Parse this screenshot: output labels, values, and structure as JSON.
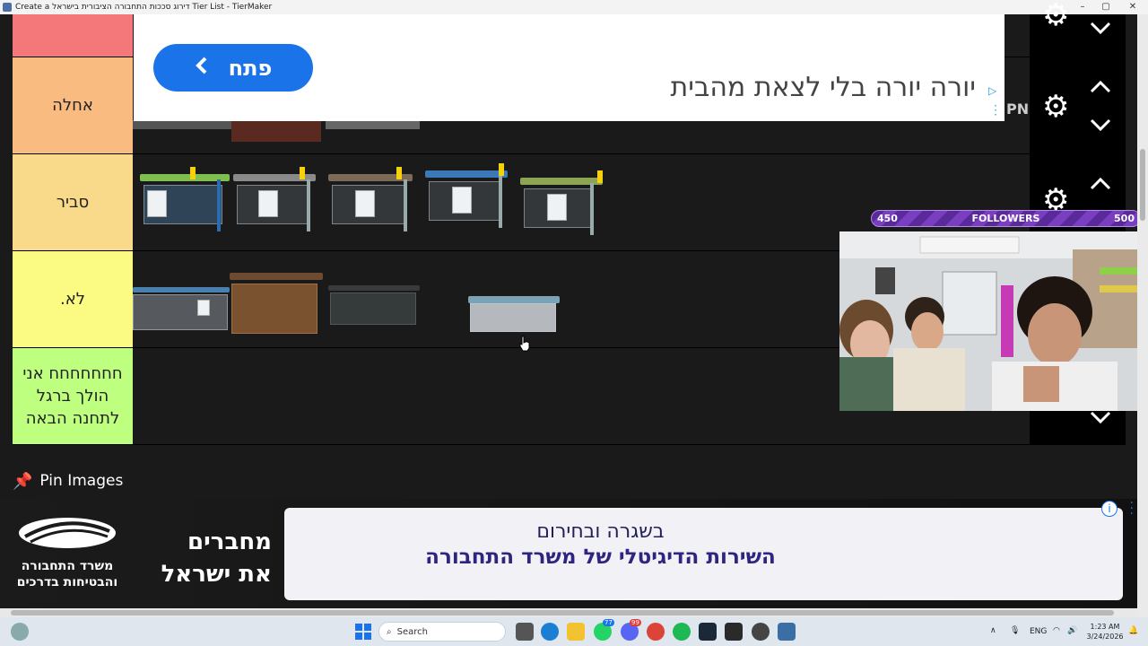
{
  "window": {
    "title": "Create a דירוג סככות התחבורה הציבורית בישראל Tier List - TierMaker"
  },
  "tiers": [
    {
      "label": "",
      "color": "#f4777a"
    },
    {
      "label": "אחלה",
      "color": "#f9bb80"
    },
    {
      "label": "סביר",
      "color": "#f9d98a"
    },
    {
      "label": "לא.",
      "color": "#fbfb83"
    },
    {
      "label": "חחחחחחח אני הולך ברגל לתחנה הבאה",
      "color": "#bfff80"
    }
  ],
  "ad_top": {
    "button_label": "פתח",
    "headline": "יורה יורה בלי לצאת מהבית",
    "brand_text": "PN"
  },
  "stream": {
    "followers_label": "FOLLOWERS",
    "followers_current": "450",
    "followers_goal": "500",
    "progress": 0.9
  },
  "pin_images": {
    "label": "Pin Images"
  },
  "ad_bottom": {
    "logo_line1": "משרד התחבורה",
    "logo_line2": "והבטיחות בדרכים",
    "slogan_line1": "מחברים",
    "slogan_line2": "את ישראל",
    "panel_line1": "בשגרה ובחירום",
    "panel_line2": "השירות הדיגיטלי של משרד התחבורה"
  },
  "taskbar": {
    "search_placeholder": "Search",
    "language": "ENG",
    "time": "1:23 AM",
    "date": "3/24/2026",
    "badge_whatsapp": "77",
    "badge_discord": "99"
  },
  "icons": [
    "gear-icon",
    "chevron-up-icon",
    "chevron-down-icon",
    "pin-icon",
    "windows-start-icon",
    "search-icon",
    "ad-choices-icon",
    "info-icon"
  ]
}
